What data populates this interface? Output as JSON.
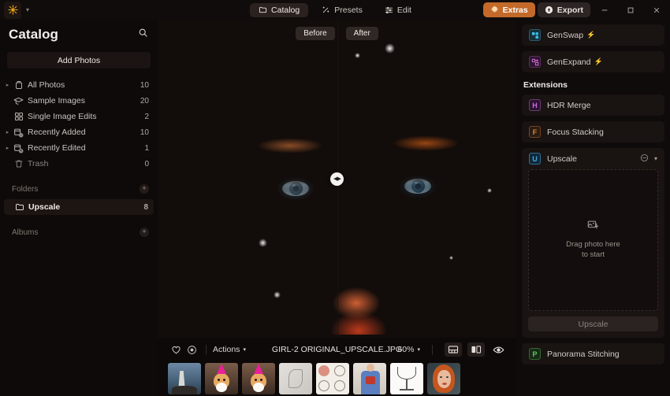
{
  "titlebar": {
    "logo_icon": "sun-burst-logo",
    "caret_icon": "chevron-down-icon",
    "tabs": [
      {
        "label": "Catalog",
        "icon": "folder-icon",
        "active": true
      },
      {
        "label": "Presets",
        "icon": "magic-wand-icon",
        "active": false
      },
      {
        "label": "Edit",
        "icon": "sliders-icon",
        "active": false
      }
    ],
    "extras_label": "Extras",
    "extras_icon": "puzzle-piece-icon",
    "extras_color": "#c36a2a",
    "export_label": "Export",
    "export_icon": "upload-circle-icon",
    "window_minimize": "minimize-icon",
    "window_maximize": "maximize-icon",
    "window_close": "close-icon"
  },
  "sidebar": {
    "title": "Catalog",
    "search_icon": "search-icon",
    "add_photos_label": "Add Photos",
    "items": [
      {
        "label": "All Photos",
        "count": "10",
        "icon": "photo-stack-icon",
        "chevron": true,
        "dim": false
      },
      {
        "label": "Sample Images",
        "count": "20",
        "icon": "graduation-cap-icon",
        "chevron": false,
        "dim": false
      },
      {
        "label": "Single Image Edits",
        "count": "2",
        "icon": "grid-icon",
        "chevron": false,
        "dim": false
      },
      {
        "label": "Recently Added",
        "count": "10",
        "icon": "recent-added-icon",
        "chevron": true,
        "dim": false
      },
      {
        "label": "Recently Edited",
        "count": "1",
        "icon": "recent-edited-icon",
        "chevron": true,
        "dim": false
      },
      {
        "label": "Trash",
        "count": "0",
        "icon": "trash-icon",
        "chevron": false,
        "dim": true
      }
    ],
    "folders_section": {
      "label": "Folders",
      "add_icon": "plus-circle-icon"
    },
    "folders": [
      {
        "label": "Upscale",
        "count": "8",
        "icon": "folder-icon",
        "selected": true
      }
    ],
    "albums_section": {
      "label": "Albums",
      "add_icon": "plus-circle-icon"
    }
  },
  "viewer": {
    "before_label": "Before",
    "after_label": "After",
    "divider_handle_icon": "drag-handle-arrows-icon"
  },
  "viewer_toolbar": {
    "favorite_icon": "heart-icon",
    "reject_icon": "circle-dot-icon",
    "actions_label": "Actions",
    "actions_caret": "chevron-down-icon",
    "filename": "GIRL-2 ORIGINAL_UPSCALE.JPG",
    "zoom_level": "60%",
    "zoom_caret": "chevron-down-icon",
    "filmstrip_toggle_icon": "filmstrip-view-icon",
    "compare_toggle_icon": "split-compare-icon",
    "preview_icon": "eye-icon"
  },
  "filmstrip": {
    "thumbnails": [
      {
        "name": "lighthouse-photo",
        "selected": false
      },
      {
        "name": "corgi-party-hat-photo",
        "selected": false
      },
      {
        "name": "corgi-party-hat-photo",
        "selected": false
      },
      {
        "name": "sand-drawing-photo",
        "selected": false
      },
      {
        "name": "sketch-grid-photo",
        "selected": false
      },
      {
        "name": "woman-tshirt-photo",
        "selected": false
      },
      {
        "name": "wine-glass-photo",
        "selected": false
      },
      {
        "name": "redhead-girl-photo",
        "selected": true
      }
    ]
  },
  "right_panel": {
    "top_cards": [
      {
        "label": "GenSwap",
        "badge": "S",
        "badge_color": "#3fb8e0",
        "bolt": "⚡"
      },
      {
        "label": "GenExpand",
        "badge": "E",
        "badge_color": "#d66fd6",
        "bolt": "⚡"
      }
    ],
    "extensions_label": "Extensions",
    "extensions": [
      {
        "label": "HDR Merge",
        "badge": "H",
        "badge_color": "#d26ae0",
        "expanded": false
      },
      {
        "label": "Focus Stacking",
        "badge": "F",
        "badge_color": "#d2844a",
        "expanded": false
      }
    ],
    "upscale": {
      "label": "Upscale",
      "badge": "U",
      "badge_color": "#4aa6d8",
      "collapse_icon": "minus-circle-icon",
      "chevron_icon": "chevron-down-icon",
      "dropzone_icon": "image-placeholder-icon",
      "dropzone_line1": "Drag photo here",
      "dropzone_line2": "to start",
      "action_label": "Upscale"
    },
    "bottom_cards": [
      {
        "label": "Panorama Stitching",
        "badge": "P",
        "badge_color": "#68c268"
      }
    ]
  }
}
